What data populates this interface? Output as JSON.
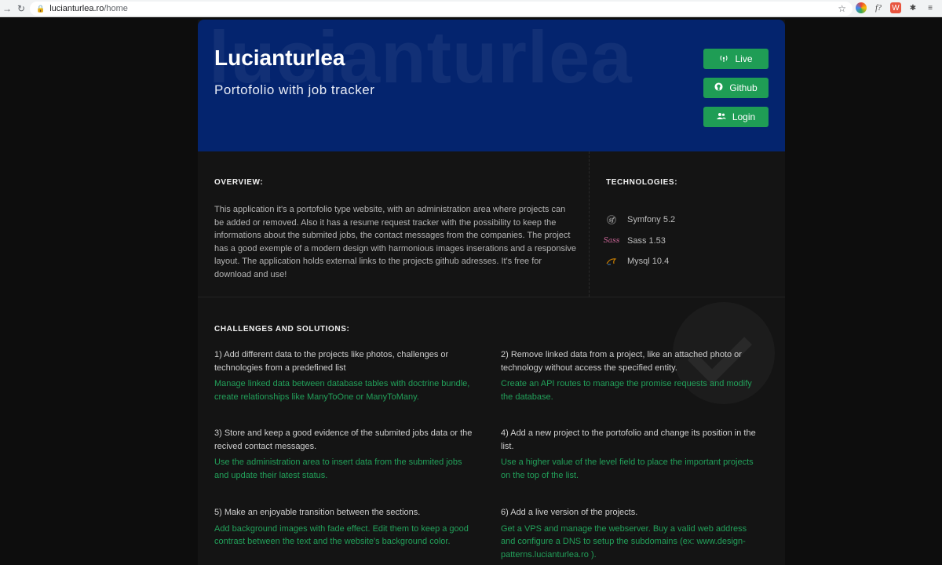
{
  "browser": {
    "url_domain": "lucianturlea.ro",
    "url_path": "/home"
  },
  "hero": {
    "watermark": "lucianturlea",
    "title": "Lucianturlea",
    "subtitle": "Portofolio with job tracker",
    "buttons": [
      {
        "label": "Live",
        "icon": "antenna-icon"
      },
      {
        "label": "Github",
        "icon": "github-icon"
      },
      {
        "label": "Login",
        "icon": "users-icon"
      }
    ]
  },
  "overview": {
    "title": "OVERVIEW:",
    "text": "This application it's a portofolio type website, with an administration area where projects can be added or removed. Also it has a resume request tracker with the possibility to keep the informations about the submited jobs, the contact messages from the companies. The project has a good exemple of a modern design with harmonious images inserations and a responsive layout. The application holds external links to the projects github adresses. It's free for download and use!"
  },
  "technologies": {
    "title": "TECHNOLOGIES:",
    "items": [
      {
        "label": "Symfony 5.2",
        "icon": "symfony-icon",
        "color": "#cccccc"
      },
      {
        "label": "Sass 1.53",
        "icon": "sass-icon",
        "color": "#cd6799"
      },
      {
        "label": "Mysql 10.4",
        "icon": "mysql-icon",
        "color": "#e48e00"
      }
    ]
  },
  "challenges": {
    "title": "CHALLENGES AND SOLUTIONS:",
    "items": [
      {
        "question": "1) Add different data to the projects like photos, challenges or technologies from a predefined list",
        "answer": "Manage linked data between database tables with doctrine bundle, create relationships like ManyToOne or ManyToMany."
      },
      {
        "question": "2) Remove linked data from a project, like an attached photo or technology without access the specified entity.",
        "answer": "Create an API routes to manage the promise requests and modify the database."
      },
      {
        "question": "3) Store and keep a good evidence of the submited jobs data or the recived contact messages.",
        "answer": "Use the administration area to insert data from the submited jobs and update their latest status."
      },
      {
        "question": "4) Add a new project to the portofolio and change its position in the list.",
        "answer": "Use a higher value of the level field to place the important projects on the top of the list."
      },
      {
        "question": "5) Make an enjoyable transition between the sections.",
        "answer": "Add background images with fade effect. Edit them to keep a good contrast between the text and the website's background color."
      },
      {
        "question": "6) Add a live version of the projects.",
        "answer": "Get a VPS and manage the webserver. Buy a valid web address and configure a DNS to setup the subdomains (ex: www.design-patterns.lucianturlea.ro )."
      }
    ]
  },
  "colors": {
    "hero_bg": "#04246e",
    "button_green": "#1f9d55",
    "answer_green": "#22a05a"
  }
}
